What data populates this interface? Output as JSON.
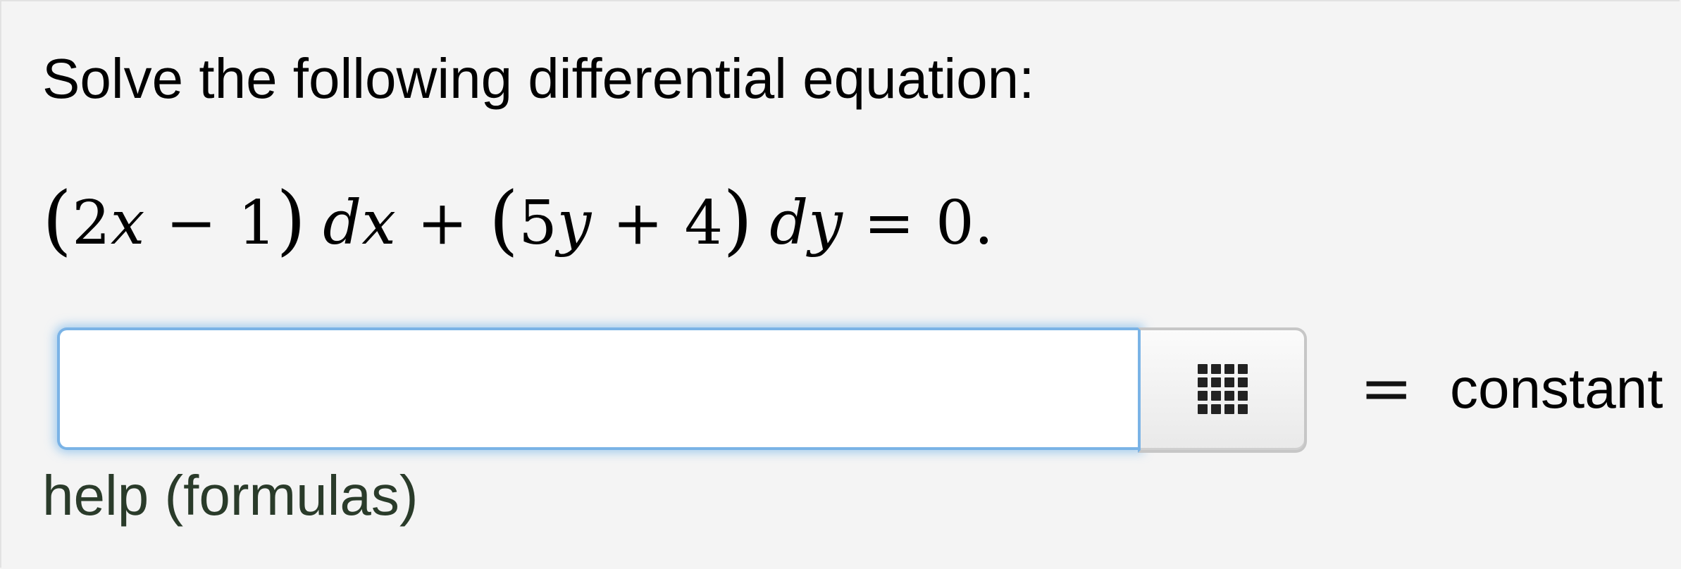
{
  "question": {
    "prompt": "Solve the following differential equation:",
    "equation": {
      "open1": "(",
      "coef1": "2",
      "var1": "x",
      "minus": "−",
      "const1": "1",
      "close1": ")",
      "d1": "dx",
      "plus1": "+",
      "open2": "(",
      "coef2": "5",
      "var2": "y",
      "plus2": "+",
      "const2": "4",
      "close2": ")",
      "d2": "dy",
      "eq": "=",
      "rhs": "0."
    }
  },
  "answer": {
    "value": "",
    "placeholder": "",
    "palette_icon": "grid-icon",
    "equals": "=",
    "suffix": "constant"
  },
  "help": {
    "label": "help (formulas)"
  },
  "colors": {
    "focus_border": "#7ab3e6",
    "help_link": "#2a3b2a",
    "background": "#f4f4f4"
  }
}
